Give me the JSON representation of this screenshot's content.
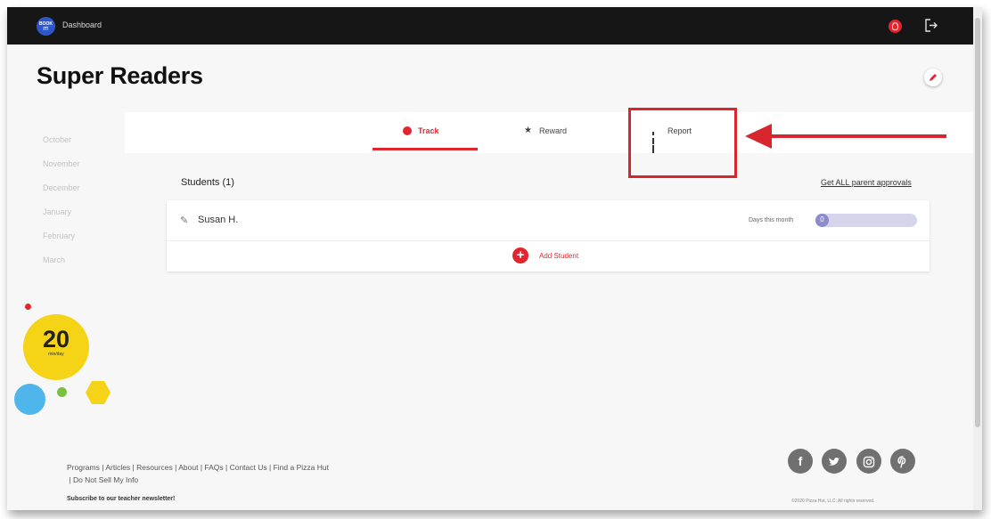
{
  "topbar": {
    "logo_text": "BOOK IT!",
    "dashboard_label": "Dashboard",
    "logout_icon": "logout-icon",
    "avatar_icon": "user-icon"
  },
  "header": {
    "title": "Super Readers",
    "edit_icon": "pencil-icon"
  },
  "sidebar": {
    "months": [
      "October",
      "November",
      "December",
      "January",
      "February",
      "March"
    ],
    "badge": {
      "number": "20",
      "unit": "min/day"
    }
  },
  "tabs": [
    {
      "label": "Track",
      "icon": "track-icon",
      "active": true
    },
    {
      "label": "Reward",
      "icon": "star-icon",
      "active": false
    },
    {
      "label": "Report",
      "icon": "bar-chart-icon",
      "active": false
    }
  ],
  "students": {
    "title": "Students (1)",
    "approvals_link": "Get ALL parent approvals",
    "rows": [
      {
        "name": "Susan H.",
        "days_label": "Days this month",
        "days": "0"
      }
    ],
    "add_label": "Add Student"
  },
  "footer": {
    "links": [
      "Programs",
      "Articles",
      "Resources",
      "About",
      "FAQs",
      "Contact Us",
      "Find a Pizza Hut",
      "Do Not Sell My Info"
    ],
    "newsletter": "Subscribe to our teacher newsletter!",
    "socials": [
      "facebook-icon",
      "twitter-icon",
      "instagram-icon",
      "pinterest-icon"
    ],
    "copyright": "©2020 Pizza Hut, LLC. All rights reserved."
  },
  "colors": {
    "accent": "#e3262d",
    "annotation": "#d7262e",
    "badge_yellow": "#f5d316",
    "dot_blue": "#4fb6ec",
    "dot_green": "#7bc043"
  }
}
